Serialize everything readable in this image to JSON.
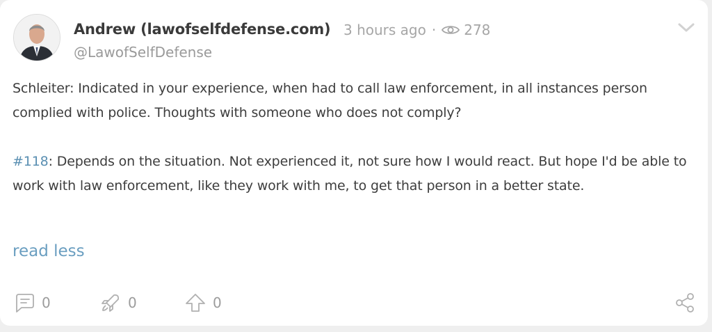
{
  "post": {
    "author_name": "Andrew (lawofselfdefense.com)",
    "time_ago": "3 hours ago",
    "separator": "·",
    "views": "278",
    "handle": "@LawofSelfDefense",
    "paragraph1": "Schleiter: Indicated in your experience, when had to call law enforcement, in all instances person complied with police. Thoughts with someone who does not comply?",
    "hashtag": "#118",
    "paragraph2_rest": ": Depends on the situation. Not experienced it, not sure how I would react. But hope I'd be able to work with law enforcement, like they work with me, to get that person in a better state.",
    "read_less": "read less"
  },
  "actions": {
    "comments": "0",
    "reposts": "0",
    "upvotes": "0"
  },
  "icons": {
    "avatar": "author-photo",
    "views": "eye-icon",
    "menu": "chevron-down-icon",
    "comment": "comment-icon",
    "repost": "rocket-icon",
    "upvote": "arrow-up-icon",
    "share": "share-icon"
  },
  "colors": {
    "card_bg": "#ffffff",
    "page_bg": "#efefef",
    "text": "#3d3d3d",
    "muted": "#a6a6a6",
    "link": "#6a9ec0"
  }
}
